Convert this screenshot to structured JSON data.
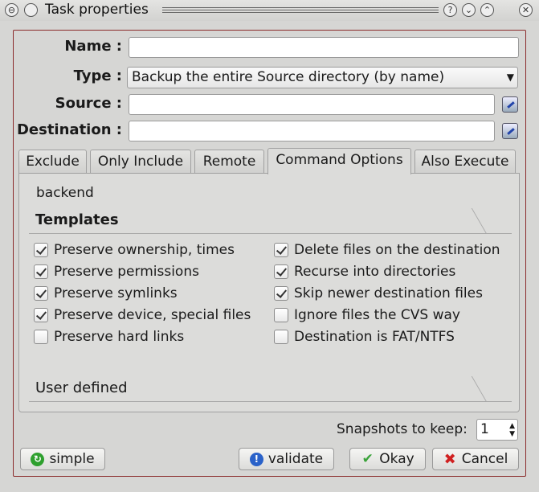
{
  "window": {
    "title": "Task properties"
  },
  "form": {
    "name_label": "Name :",
    "type_label": "Type :",
    "type_value": "Backup the entire Source directory (by name)",
    "source_label": "Source :",
    "destination_label": "Destination :",
    "name_value": "",
    "source_value": "",
    "destination_value": ""
  },
  "tabs": [
    {
      "label": "Exclude"
    },
    {
      "label": "Only Include"
    },
    {
      "label": "Remote"
    },
    {
      "label": "Command Options",
      "active": true
    },
    {
      "label": "Also Execute"
    }
  ],
  "panel": {
    "backend": "backend",
    "templates_title": "Templates",
    "user_defined_title": "User defined",
    "options": [
      {
        "label": "Preserve ownership, times",
        "checked": true
      },
      {
        "label": "Preserve permissions",
        "checked": true
      },
      {
        "label": "Preserve symlinks",
        "checked": true
      },
      {
        "label": "Preserve device, special files",
        "checked": true
      },
      {
        "label": "Preserve hard links",
        "checked": false
      },
      {
        "label": "Delete files on the destination",
        "checked": true
      },
      {
        "label": "Recurse into directories",
        "checked": true
      },
      {
        "label": "Skip newer destination files",
        "checked": true
      },
      {
        "label": "Ignore files the CVS way",
        "checked": false
      },
      {
        "label": "Destination is FAT/NTFS",
        "checked": false
      }
    ]
  },
  "snapshots": {
    "label": "Snapshots to keep:",
    "value": "1"
  },
  "buttons": {
    "simple": "simple",
    "validate": "validate",
    "okay": "Okay",
    "cancel": "Cancel"
  },
  "colors": {
    "frame": "#8b2b2b",
    "validate_icon": "#2a62c9",
    "okay_icon": "#3aa33a",
    "cancel_icon": "#d02020",
    "simple_icon": "#2ea02e"
  }
}
